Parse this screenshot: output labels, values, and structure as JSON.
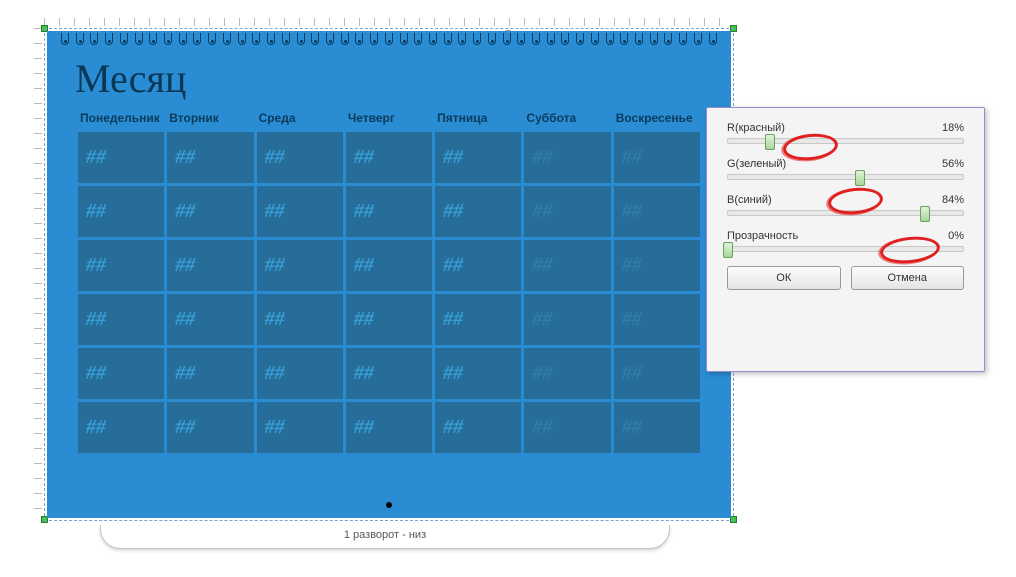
{
  "overlay_label": "",
  "calendar": {
    "title": "Месяц",
    "weekdays": [
      "Понедельник",
      "Вторник",
      "Среда",
      "Четверг",
      "Пятница",
      "Суббота",
      "Воскресенье"
    ],
    "cell_placeholder": "##"
  },
  "spread_label": "1 разворот - низ",
  "dialog": {
    "sliders": [
      {
        "label": "R(красный)",
        "value_text": "18%",
        "percent": 18
      },
      {
        "label": "G(зеленый)",
        "value_text": "56%",
        "percent": 56
      },
      {
        "label": "B(синий)",
        "value_text": "84%",
        "percent": 84
      },
      {
        "label": "Прозрачность",
        "value_text": "0%",
        "percent": 0
      }
    ],
    "ok": "ОК",
    "cancel": "Отмена"
  },
  "chart_data": {
    "type": "table",
    "title": "RGB color sliders",
    "series": [
      {
        "name": "R(красный)",
        "values": [
          18
        ]
      },
      {
        "name": "G(зеленый)",
        "values": [
          56
        ]
      },
      {
        "name": "B(синий)",
        "values": [
          84
        ]
      },
      {
        "name": "Прозрачность",
        "values": [
          0
        ]
      }
    ],
    "ylim": [
      0,
      100
    ],
    "ylabel": "%"
  }
}
